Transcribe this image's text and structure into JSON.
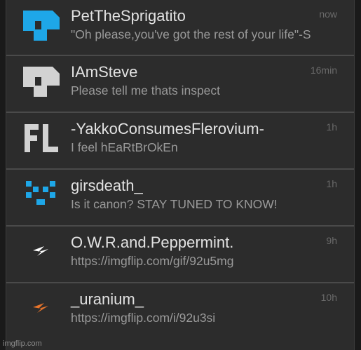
{
  "notifications": [
    {
      "username": "PetTheSprigatito",
      "message": "\"Oh please,you've got the rest of your life\"-S",
      "time": "now",
      "avatar_icon": "blue-block-icon",
      "avatar_color": "#1ea7e8"
    },
    {
      "username": "IAmSteve",
      "message": "Please tell me thats inspect",
      "time": "16min",
      "avatar_icon": "gray-block-icon",
      "avatar_color": "#d2d2d2"
    },
    {
      "username": "-YakkoConsumesFlerovium-",
      "message": "I feel hEaRtBrOkEn",
      "time": "1h",
      "avatar_icon": "fl-letters-icon",
      "avatar_color": "#d2d2d2"
    },
    {
      "username": "girsdeath_",
      "message": "Is it canon? STAY TUNED TO KNOW!",
      "time": "1h",
      "avatar_icon": "blue-pixel-face-icon",
      "avatar_color": "#1ea7e8"
    },
    {
      "username": "O.W.R.and.Peppermint.",
      "message": "https://imgflip.com/gif/92u5mg",
      "time": "9h",
      "avatar_icon": "white-lightning-icon",
      "avatar_color": "#ffffff"
    },
    {
      "username": "_uranium_",
      "message": "https://imgflip.com/i/92u3si",
      "time": "10h",
      "avatar_icon": "orange-lightning-icon",
      "avatar_color": "#e8742a"
    }
  ],
  "watermark": "imgflip.com"
}
